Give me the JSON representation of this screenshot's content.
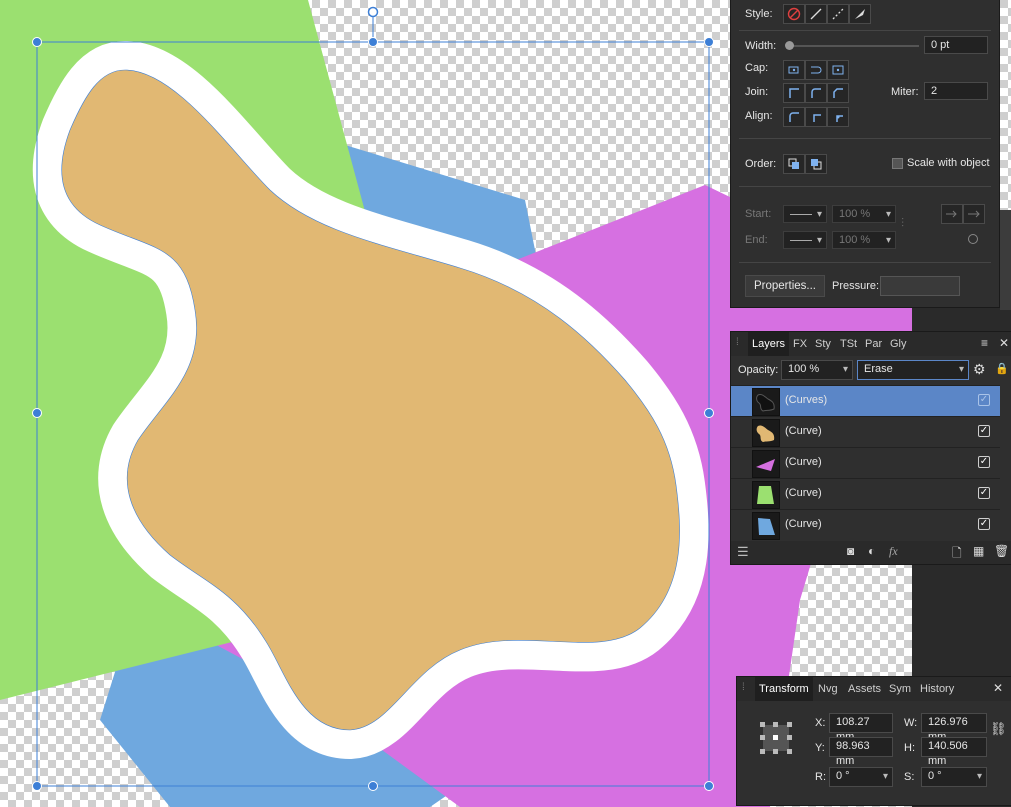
{
  "stroke_panel": {
    "style_label": "Style:",
    "width_label": "Width:",
    "width_value": "0 pt",
    "cap_label": "Cap:",
    "join_label": "Join:",
    "miter_label": "Miter:",
    "miter_value": "2",
    "align_label": "Align:",
    "order_label": "Order:",
    "scale_label": "Scale with object",
    "start_label": "Start:",
    "end_label": "End:",
    "start_pct": "100 %",
    "end_pct": "100 %",
    "properties_button": "Properties...",
    "pressure_label": "Pressure:"
  },
  "layers_panel": {
    "tabs": [
      "Layers",
      "FX",
      "Sty",
      "TSt",
      "Par",
      "Gly"
    ],
    "opacity_label": "Opacity:",
    "opacity_value": "100 %",
    "blend_mode": "Erase",
    "layers": [
      {
        "name": "(Curves)",
        "selected": true,
        "color": "#1a1a1a"
      },
      {
        "name": "(Curve)",
        "selected": false,
        "color": "#e1b873"
      },
      {
        "name": "(Curve)",
        "selected": false,
        "color": "#d670e1"
      },
      {
        "name": "(Curve)",
        "selected": false,
        "color": "#9be070"
      },
      {
        "name": "(Curve)",
        "selected": false,
        "color": "#6fa8df"
      }
    ]
  },
  "transform_panel": {
    "tabs": [
      "Transform",
      "Nvg",
      "Assets",
      "Sym",
      "History"
    ],
    "x_label": "X:",
    "x_value": "108.27 mm",
    "y_label": "Y:",
    "y_value": "98.963 mm",
    "w_label": "W:",
    "w_value": "126.976 mm",
    "h_label": "H:",
    "h_value": "140.506 mm",
    "r_label": "R:",
    "r_value": "0 °",
    "s_label": "S:",
    "s_value": "0 °"
  },
  "colors": {
    "green": "#9be070",
    "blue": "#6fa8df",
    "magenta": "#d670e1",
    "tan": "#e1b873",
    "selection": "#3d7fd6",
    "panel_bg": "#2f2f2f"
  }
}
